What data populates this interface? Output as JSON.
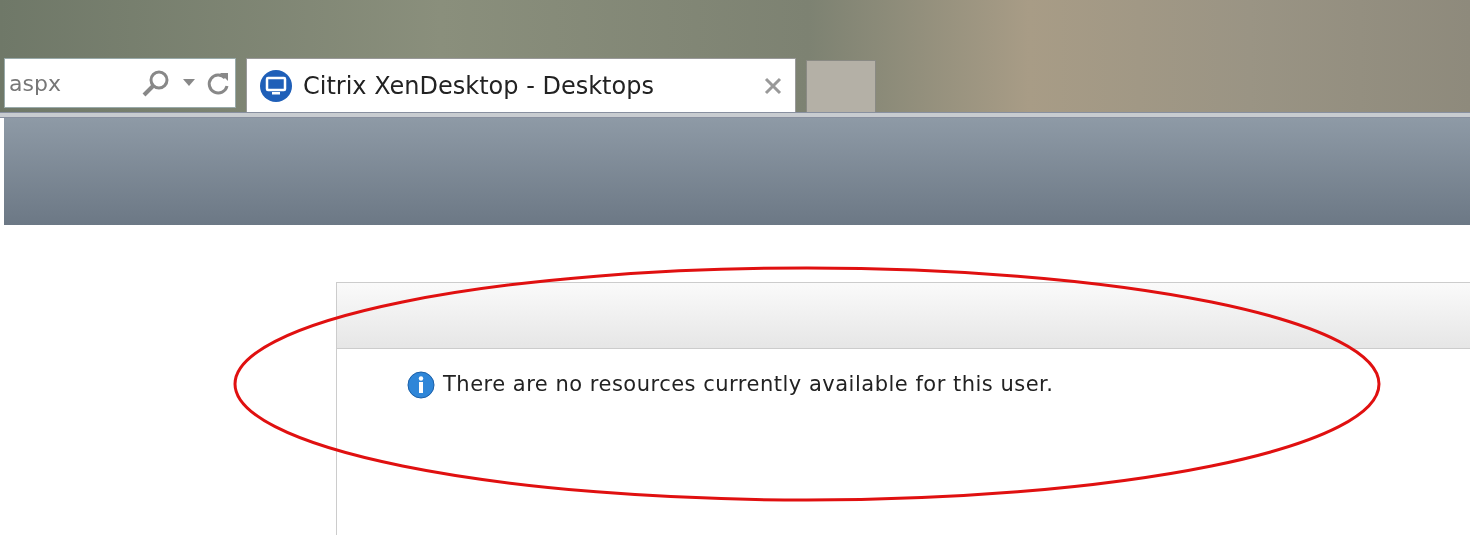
{
  "address_bar": {
    "value": "aspx"
  },
  "tabs": [
    {
      "title": "Citrix XenDesktop - Desktops",
      "selected": true
    }
  ],
  "message": {
    "text": "There are no resources currently available for this user."
  }
}
